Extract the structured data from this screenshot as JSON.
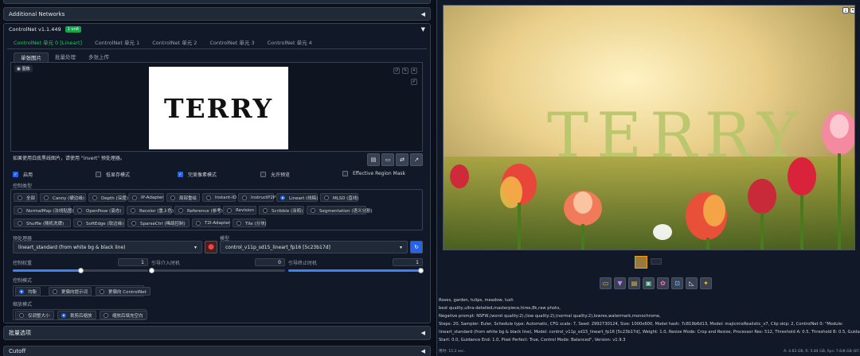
{
  "left": {
    "partial_top": "",
    "additional_networks": "Additional Networks",
    "controlnet_title": "ControlNet v1.1.449",
    "controlnet_badge": "1 unit",
    "unit_tabs": [
      "ControlNet 单元 0 [Lineart]",
      "ControlNet 单元 1",
      "ControlNet 单元 2",
      "ControlNet 单元 3",
      "ControlNet 单元 4"
    ],
    "image_tabs": [
      "单张图片",
      "批量处理",
      "多张上传"
    ],
    "image_label": "图像",
    "canvas_text": "TERRY",
    "invert_hint": "如果使用白底黑线图片，请使用 \"invert\" 预处理器。",
    "checkboxes": [
      {
        "label": "启用",
        "checked": true
      },
      {
        "label": "低显存模式",
        "checked": false
      },
      {
        "label": "完美像素模式",
        "checked": true
      },
      {
        "label": "允许预览",
        "checked": false
      },
      {
        "label": "Effective Region Mask",
        "checked": false
      }
    ],
    "control_type_label": "控制类型",
    "control_types": [
      [
        "全部",
        "Canny (硬边缘)",
        "Depth (深度)",
        "IP-Adapter",
        "局部重绘",
        "Instant-ID",
        "InstructP2P",
        "Lineart (线稿)",
        "MLSD (直线)"
      ],
      [
        "NormalMap (法线贴图)",
        "OpenPose (姿态)",
        "Recolor (重上色)",
        "Reference (参考)",
        "Revision",
        "Scribble (涂鸦)",
        "Segmentation (语义分割)"
      ],
      [
        "Shuffle (随机洗牌)",
        "SoftEdge (软边缘)",
        "SparseCtrl (稀疏控制)",
        "T2I-Adapter",
        "Tile (分块)"
      ]
    ],
    "control_type_selected": "Lineart (线稿)",
    "preprocessor_label": "预处理器",
    "preprocessor_value": "lineart_standard (from white bg & black line)",
    "model_label": "模型",
    "model_value": "control_v11p_sd15_lineart_fp16 [5c23b17d]",
    "weight_label": "控制权重",
    "weight_value": "1",
    "weight_fraction": 0.5,
    "start_label": "引导介入时机",
    "start_value": "0",
    "start_fraction": 0,
    "end_label": "引导终止时机",
    "end_value": "1",
    "end_fraction": 1,
    "control_mode_label": "控制模式",
    "control_modes": [
      "均衡",
      "更偏向提示词",
      "更偏向 ControlNet"
    ],
    "control_mode_selected": "均衡",
    "resize_mode_label": "缩放模式",
    "resize_modes": [
      "仅调整大小",
      "裁剪后缩放",
      "缩放后填充空白"
    ],
    "resize_mode_selected": "裁剪后缩放",
    "batch_options": "批量选项",
    "cutoff": "Cutoff"
  },
  "right": {
    "photo_word": "TERRY",
    "thumb_label": "",
    "info_lines": [
      "Roses, garden, tulips, meadow, lush",
      "best quality,ultra-detailed,masterpiece,hires,8k,raw photo,",
      "Negative prompt: NSFW,(worst quality:2),(low quality:2),(normal quality:2),lowres,watermark,monochrome,",
      "Steps: 20, Sampler: Euler, Schedule type: Automatic, CFG scale: 7, Seed: 2992730124, Size: 1000x600, Model hash: 7c819b6d13, Model: majicmixRealistic_v7, Clip skip: 2, ControlNet 0: \"Module:",
      "lineart_standard (from white bg & black line), Model: control_v11p_sd15_lineart_fp16 [5c23b17d], Weight: 1.0, Resize Mode: Crop and Resize, Processor Res: 512, Threshold A: 0.5, Threshold B: 0.5, Guidance",
      "Start: 0.0, Guidance End: 1.0, Pixel Perfect: True, Control Mode: Balanced\", Version: v1.9.3"
    ],
    "time_taken": "用时: 15.2 sec.",
    "memory": "A: 4.83 GB, R: 5.84 GB, Sys: 7.6/8 GB (87.4%)",
    "toolbar_icons": [
      "folder-icon",
      "save-icon",
      "zip-icon",
      "image-icon",
      "palette-icon",
      "crop-icon",
      "ruler-icon",
      "sparkle-icon"
    ],
    "accent_color": "#22c55e"
  }
}
